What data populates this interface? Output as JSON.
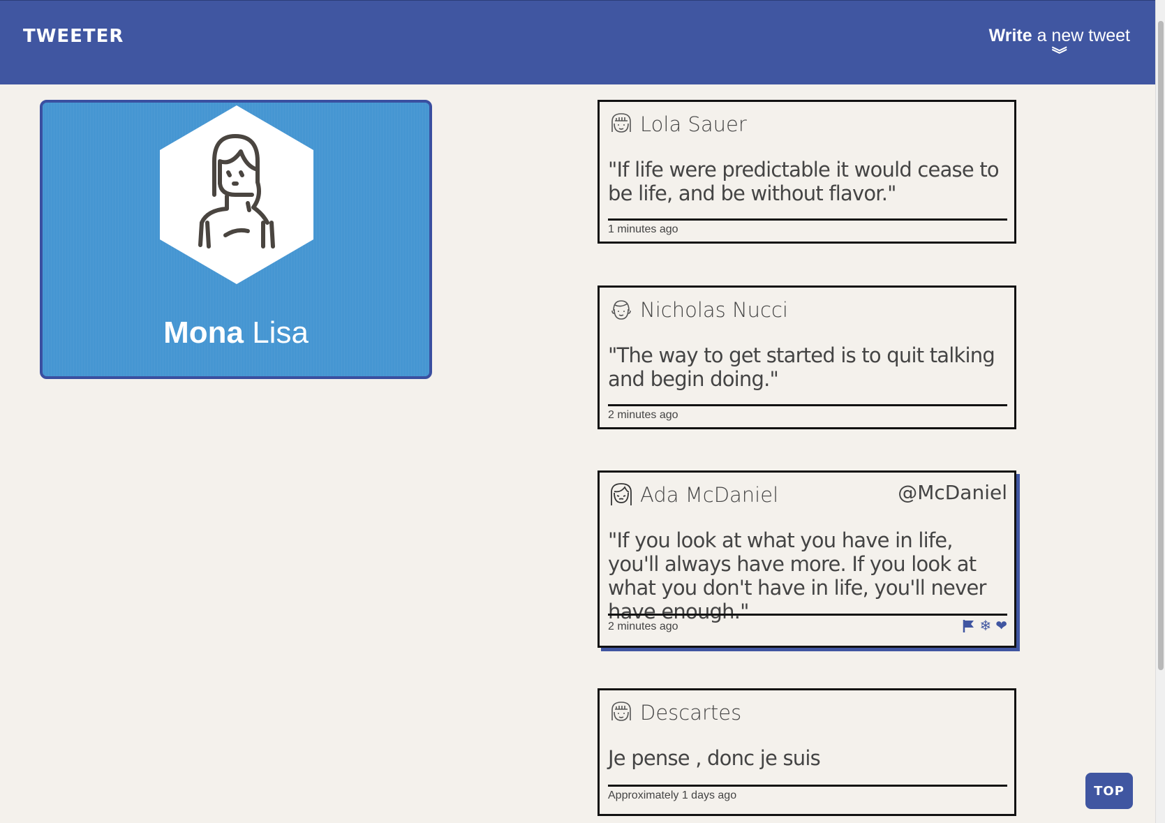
{
  "header": {
    "brand": "TWEETER",
    "compose_bold": "Write",
    "compose_rest": " a new tweet",
    "compose_icon": "double-chevron-down-icon"
  },
  "profile": {
    "first_name": "Mona",
    "last_name": "Lisa",
    "avatar_icon": "woman-avatar-icon",
    "background_color": "#4696d2"
  },
  "tweets": [
    {
      "author": "Lola Sauer",
      "handle": "",
      "text": "\"If life were predictable it would cease to be life, and be without flavor.\"",
      "time": "1 minutes ago",
      "avatar_icon": "girl-avatar-icon"
    },
    {
      "author": "Nicholas Nucci",
      "handle": "",
      "text": "\"The way to get started is to quit talking and begin doing.\"",
      "time": "2 minutes ago",
      "avatar_icon": "boy-avatar-icon"
    },
    {
      "author": "Ada McDaniel",
      "handle": "@McDaniel",
      "text": "\"If you look at what you have in life, you'll always have more. If you look at what you don't have in life, you'll never have enough.\"",
      "time": "2 minutes ago",
      "avatar_icon": "woman-avatar-icon",
      "actions": [
        "flag-icon",
        "retweet-icon",
        "heart-icon"
      ]
    },
    {
      "author": "Descartes",
      "handle": "",
      "text": "Je pense , donc je suis",
      "time": "Approximately 1 days ago",
      "avatar_icon": "girl-avatar-icon"
    }
  ],
  "top_button": "TOP",
  "colors": {
    "accent": "#4056a1",
    "page_bg": "#f4f1ec",
    "profile_bg": "#4696d2"
  }
}
